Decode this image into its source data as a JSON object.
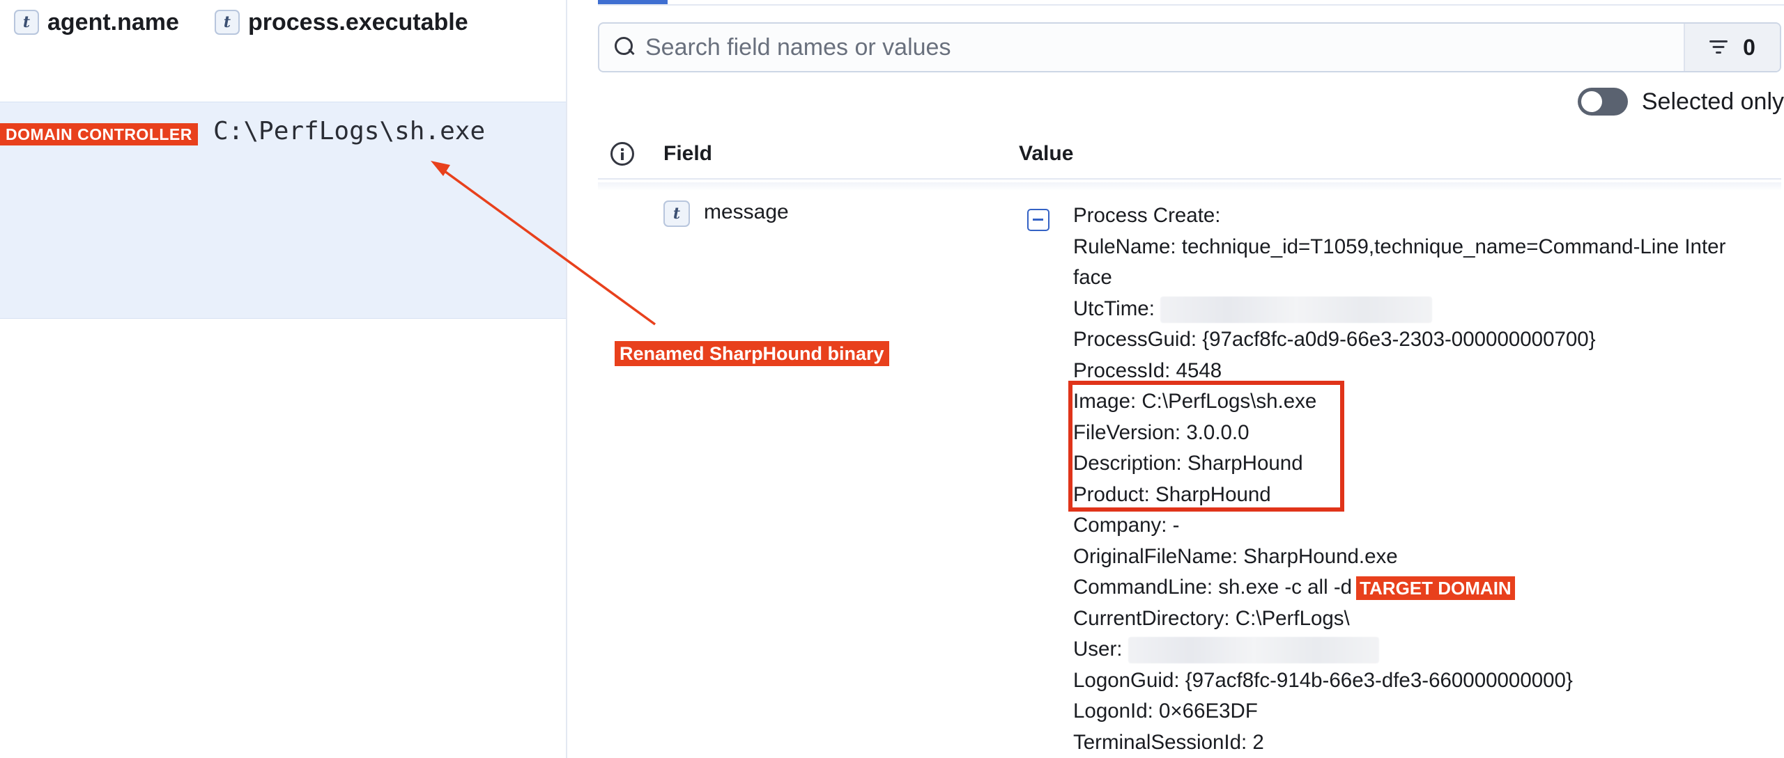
{
  "colors": {
    "accent": "#3f6fd1",
    "annotation": "#e8401c",
    "selected_row": "#e9f0fb"
  },
  "columns": [
    {
      "type": "t",
      "name": "agent.name"
    },
    {
      "type": "t",
      "name": "process.executable"
    }
  ],
  "row": {
    "agent_badge": "DOMAIN CONTROLLER",
    "executable": "C:\\PerfLogs\\sh.exe"
  },
  "annotation": {
    "label": "Renamed SharpHound binary"
  },
  "flyout": {
    "search": {
      "placeholder": "Search field names or values",
      "value": ""
    },
    "filter_count": "0",
    "selected_only_label": "Selected only",
    "table": {
      "field_header": "Field",
      "value_header": "Value"
    },
    "field": {
      "type": "t",
      "name": "message"
    },
    "message_lines": [
      "Process Create:",
      "RuleName: technique_id=T1059,technique_name=Command-Line Inter",
      "face",
      "UtcTime:",
      "ProcessGuid: {97acf8fc-a0d9-66e3-2303-000000000700}",
      "ProcessId: 4548",
      "Image: C:\\PerfLogs\\sh.exe",
      "FileVersion: 3.0.0.0",
      "Description: SharpHound",
      "Product: SharpHound",
      "Company: -",
      "OriginalFileName: SharpHound.exe",
      "CommandLine: sh.exe  -c all -d",
      "CurrentDirectory: C:\\PerfLogs\\",
      "User:",
      "LogonGuid: {97acf8fc-914b-66e3-dfe3-660000000000}",
      "LogonId: 0×66E3DF",
      "TerminalSessionId: 2"
    ],
    "command_line_badge": "TARGET DOMAIN"
  }
}
